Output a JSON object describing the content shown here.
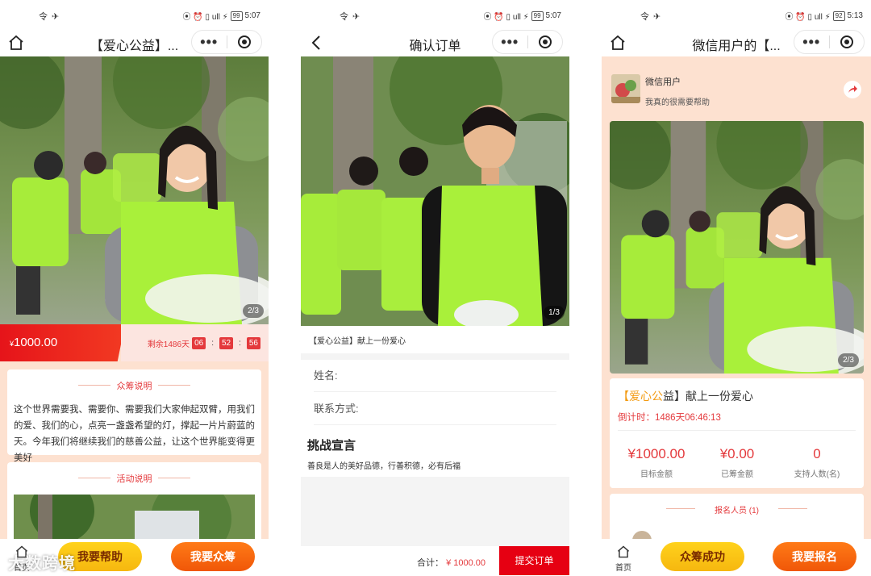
{
  "watermark": "大数跨境",
  "phones": [
    {
      "status": {
        "left": "令 ✈",
        "right": "⦿ ⏰ ▯ ull ⚡",
        "battery": "99",
        "time": "5:07"
      },
      "nav_title": "【爱心公益】...",
      "counter": "2/3",
      "price_currency": "¥",
      "price_value": "1000.00",
      "remain_label": "剩余1486天",
      "countdown": [
        "06",
        "52",
        "56"
      ],
      "colon": ":",
      "card1": {
        "title": "众筹说明",
        "body": "这个世界需要我、需要你、需要我们大家伸起双臂，用我们的爱、我们的心，点亮一盏盏希望的灯，撑起一片片蔚蓝的天。今年我们将继续我们的慈善公益，让这个世界能变得更美好"
      },
      "card2": {
        "title": "活动说明"
      },
      "tab_home": "首页",
      "btn_yellow": "我要帮助",
      "btn_orange": "我要众筹"
    },
    {
      "status": {
        "left": "令 ✈",
        "right": "⦿ ⏰ ▯ ull ⚡",
        "battery": "99",
        "time": "5:07"
      },
      "nav_title": "确认订单",
      "counter": "1/3",
      "caption": "【爱心公益】献上一份爱心",
      "name_label": "姓名:",
      "contact_label": "联系方式:",
      "challenge_title": "挑战宣言",
      "challenge_desc": "善良是人的美好品德，行善积德，必有后福",
      "total_label": "合计：",
      "total_value": "¥ 1000.00",
      "submit": "提交订单"
    },
    {
      "status": {
        "left": "令 ✈",
        "right": "⦿ ⏰ ▯ ull ⚡",
        "battery": "92",
        "time": "5:13"
      },
      "nav_title": "微信用户的【...",
      "user_name": "微信用户",
      "user_slogan": "我真的很需要帮助",
      "counter": "2/3",
      "title_bracket": "【",
      "title_highlight": "爱心公",
      "title_rest": "益】献上一份爱心",
      "countdown": "倒计时：1486天06:46:13",
      "stats": [
        {
          "value": "¥1000.00",
          "label": "目标金额"
        },
        {
          "value": "¥0.00",
          "label": "已筹金额"
        },
        {
          "value": "0",
          "label": "支持人数(名)"
        }
      ],
      "join_title": "报名人员 (1)",
      "tab_home": "首页",
      "btn_yellow": "众筹成功",
      "btn_orange": "我要报名"
    }
  ],
  "colors": {
    "red": "#e4393c",
    "orange": "#f05708",
    "yellow": "#f6b70f",
    "vest": "#a9f03a",
    "peach": "#fde1d0"
  }
}
